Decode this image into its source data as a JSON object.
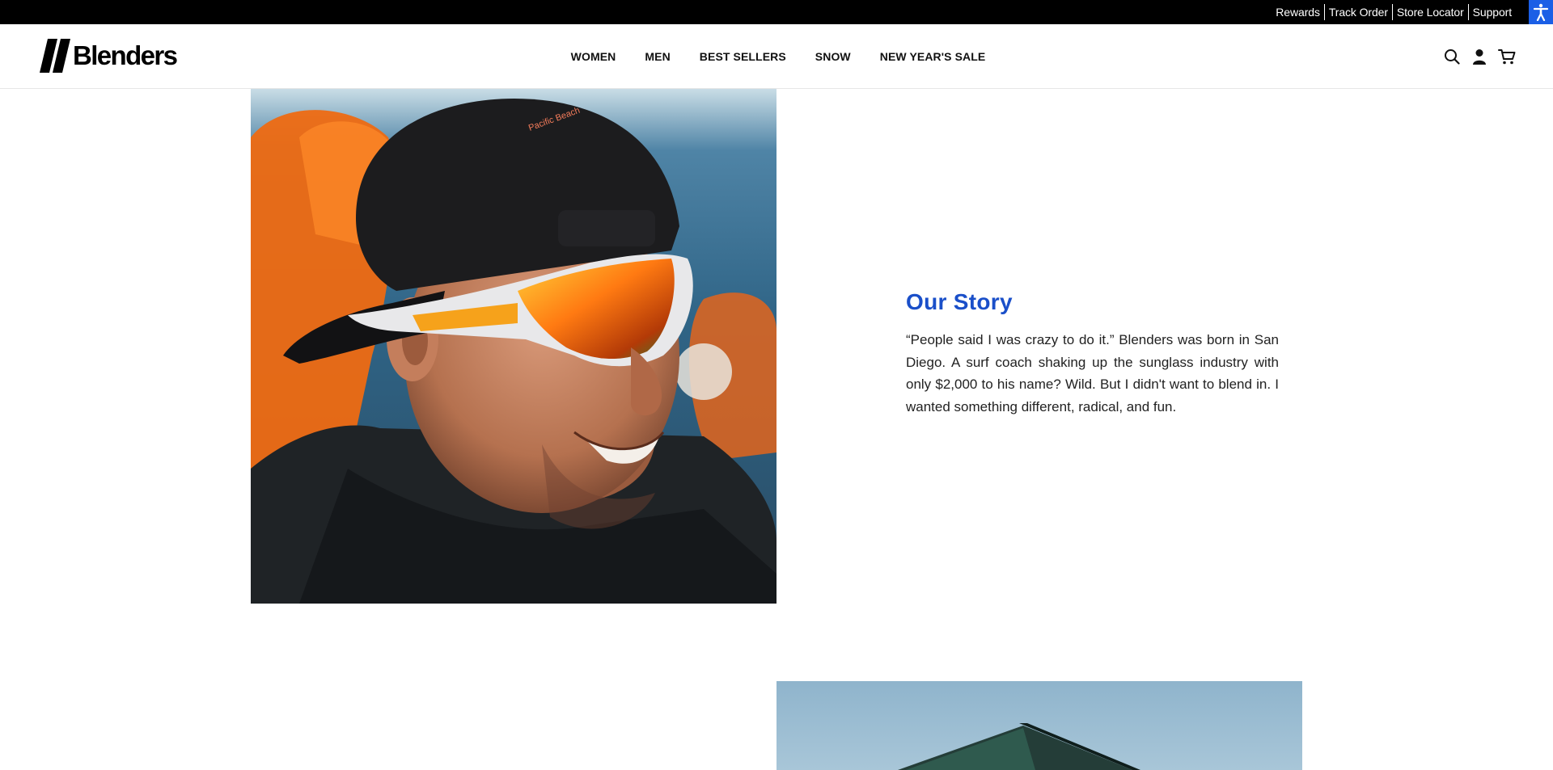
{
  "utility_nav": {
    "links": [
      "Rewards",
      "Track Order",
      "Store Locator",
      "Support"
    ]
  },
  "header": {
    "logo_text": "Blenders",
    "nav_items": [
      "WOMEN",
      "MEN",
      "BEST SELLERS",
      "SNOW",
      "NEW YEAR'S SALE"
    ],
    "icons": [
      "search-icon",
      "account-icon",
      "cart-icon"
    ]
  },
  "story": {
    "title": "Our Story",
    "body": "“People said I was crazy to do it.” Blenders was born in San Diego. A surf coach shaking up the sunglass industry with only $2,000 to his name? Wild. But I didn't want to blend in. I wanted something different, radical, and fun."
  },
  "colors": {
    "accent_blue": "#1a4fc9",
    "a11y_blue": "#1b5fe6",
    "utility_bg": "#000000"
  }
}
